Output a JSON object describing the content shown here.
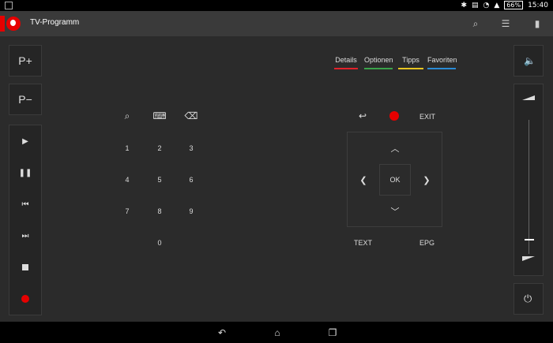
{
  "status": {
    "time": "15:40",
    "battery": "66%"
  },
  "app": {
    "title": "TV-Programm"
  },
  "left": {
    "channel_up": "P+",
    "channel_down": "P−"
  },
  "tabs": [
    {
      "label": "Details",
      "color": "#e2222b"
    },
    {
      "label": "Optionen",
      "color": "#3aa34a"
    },
    {
      "label": "Tipps",
      "color": "#e6c422"
    },
    {
      "label": "Favoriten",
      "color": "#2a8bd6"
    }
  ],
  "keypad": {
    "digits": [
      "1",
      "2",
      "3",
      "4",
      "5",
      "6",
      "7",
      "8",
      "9",
      "0"
    ]
  },
  "remote": {
    "ok": "OK",
    "exit": "EXIT",
    "text": "TEXT",
    "epg": "EPG"
  },
  "colors": {
    "vodafone_red": "#e60000"
  }
}
